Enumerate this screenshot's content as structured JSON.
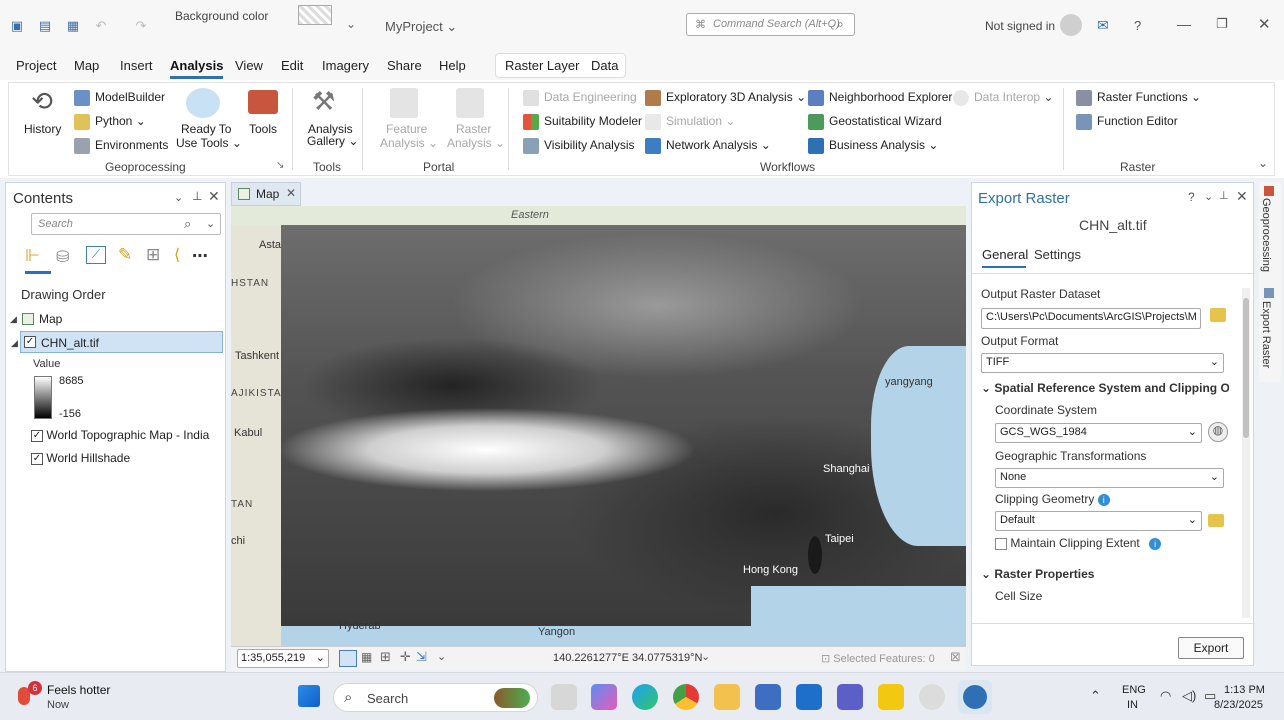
{
  "titlebar": {
    "background_color_label": "Background color",
    "project_name": "MyProject",
    "command_search_placeholder": "Command Search (Alt+Q)",
    "sign_in": "Not signed in",
    "help": "?"
  },
  "menu": {
    "items": [
      "Project",
      "Map",
      "Insert",
      "Analysis",
      "View",
      "Edit",
      "Imagery",
      "Share",
      "Help"
    ],
    "active": "Analysis",
    "context_tabs": [
      "Raster Layer",
      "Data"
    ]
  },
  "ribbon": {
    "geoprocessing": {
      "history": "History",
      "modelbuilder": "ModelBuilder",
      "python": "Python",
      "environments": "Environments",
      "ready_line1": "Ready To",
      "ready_line2": "Use Tools",
      "tools": "Tools",
      "group_label": "Geoprocessing"
    },
    "tools_group": {
      "line1": "Analysis",
      "line2": "Gallery",
      "group_label": "Tools"
    },
    "portal": {
      "feature_line1": "Feature",
      "feature_line2": "Analysis",
      "raster_line1": "Raster",
      "raster_line2": "Analysis",
      "group_label": "Portal"
    },
    "workflows": {
      "data_engineering": "Data Engineering",
      "suitability_modeler": "Suitability Modeler",
      "visibility_analysis": "Visibility Analysis",
      "exploratory_3d": "Exploratory 3D Analysis",
      "simulation": "Simulation",
      "network_analysis": "Network Analysis",
      "neighborhood_explorer": "Neighborhood Explorer",
      "geostatistical_wizard": "Geostatistical Wizard",
      "business_analysis": "Business Analysis",
      "data_interop": "Data Interop",
      "group_label": "Workflows"
    },
    "raster": {
      "raster_functions": "Raster Functions",
      "function_editor": "Function Editor",
      "group_label": "Raster"
    }
  },
  "contents": {
    "title": "Contents",
    "search_placeholder": "Search",
    "drawing_order": "Drawing Order",
    "map_label": "Map",
    "layer_selected": "CHN_alt.tif",
    "value_label": "Value",
    "value_high": "8685",
    "value_low": "-156",
    "layers": [
      "World Topographic Map - India",
      "World Hillshade"
    ]
  },
  "map_view": {
    "tab": "Map",
    "labels": {
      "eastern": "Eastern",
      "astana": "Asta",
      "stan": "HSTAN",
      "tashkent": "Tashkent",
      "ajikista": "AJIKISTA",
      "kabul": "Kabul",
      "tan": "TAN",
      "chi": "chi",
      "pyongyang": "yangyang",
      "shanghai": "Shanghai",
      "taipei": "Taipei",
      "hongkong": "Hong Kong",
      "yangon": "Yangon",
      "hyderabad": "Hyderab"
    },
    "scale": "1:35,055,219",
    "coordinates": "140.2261277°E 34.0775319°N",
    "selected_features": "Selected Features: 0"
  },
  "export_raster": {
    "title": "Export Raster",
    "subtitle": "CHN_alt.tif",
    "tabs": [
      "General",
      "Settings"
    ],
    "output_dataset_label": "Output Raster Dataset",
    "output_dataset_value": "C:\\Users\\Pc\\Documents\\ArcGIS\\Projects\\M",
    "output_format_label": "Output Format",
    "output_format_value": "TIFF",
    "spatial_section": "Spatial Reference System and Clipping Opt",
    "coord_system_label": "Coordinate System",
    "coord_system_value": "GCS_WGS_1984",
    "geo_transform_label": "Geographic Transformations",
    "geo_transform_value": "None",
    "clipping_label": "Clipping Geometry",
    "clipping_value": "Default",
    "maintain_clipping": "Maintain Clipping Extent",
    "raster_props": "Raster Properties",
    "cell_size": "Cell Size",
    "export_button": "Export",
    "side_tabs": [
      "Geoprocessing",
      "Export Raster"
    ]
  },
  "taskbar": {
    "weather_temp": "6",
    "weather_line1": "Feels hotter",
    "weather_line2": "Now",
    "search": "Search",
    "lang1": "ENG",
    "lang2": "IN",
    "time": "1:13 PM",
    "date": "8/23/2025"
  }
}
